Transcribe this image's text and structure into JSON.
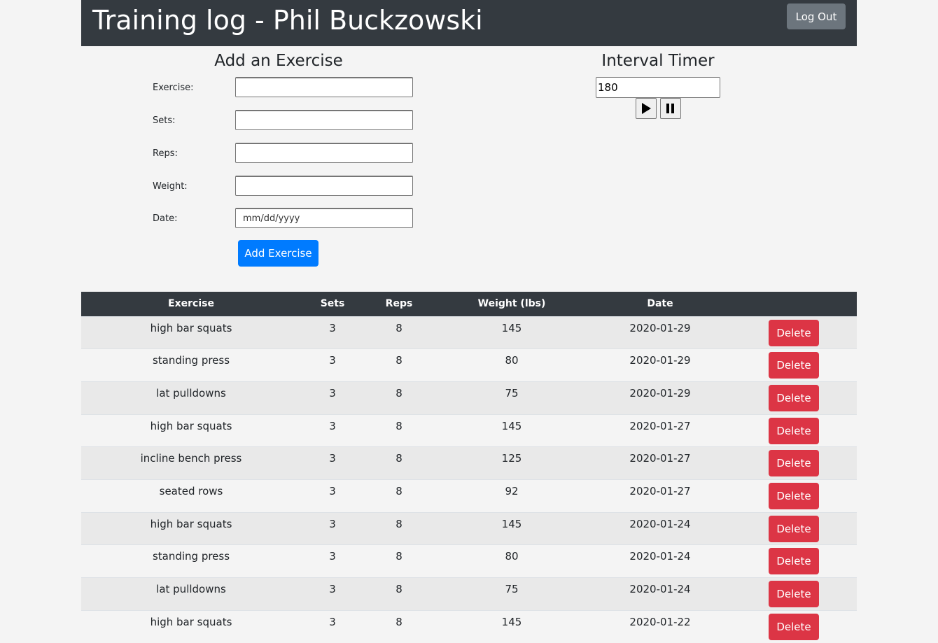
{
  "header": {
    "title": "Training log - Phil Buckzowski",
    "logout_label": "Log Out"
  },
  "add_form": {
    "title": "Add an Exercise",
    "exercise_label": "Exercise:",
    "sets_label": "Sets:",
    "reps_label": "Reps:",
    "weight_label": "Weight:",
    "date_label": "Date:",
    "exercise_value": "",
    "sets_value": "",
    "reps_value": "",
    "weight_value": "",
    "date_placeholder": "mm/dd/yyyy",
    "submit_label": "Add Exercise"
  },
  "timer": {
    "title": "Interval Timer",
    "value": "180",
    "play_icon": "play-icon",
    "pause_icon": "pause-icon"
  },
  "table": {
    "headers": [
      "Exercise",
      "Sets",
      "Reps",
      "Weight (lbs)",
      "Date",
      ""
    ],
    "delete_label": "Delete",
    "rows": [
      {
        "exercise": "high bar squats",
        "sets": "3",
        "reps": "8",
        "weight": "145",
        "date": "2020-01-29"
      },
      {
        "exercise": "standing press",
        "sets": "3",
        "reps": "8",
        "weight": "80",
        "date": "2020-01-29"
      },
      {
        "exercise": "lat pulldowns",
        "sets": "3",
        "reps": "8",
        "weight": "75",
        "date": "2020-01-29"
      },
      {
        "exercise": "high bar squats",
        "sets": "3",
        "reps": "8",
        "weight": "145",
        "date": "2020-01-27"
      },
      {
        "exercise": "incline bench press",
        "sets": "3",
        "reps": "8",
        "weight": "125",
        "date": "2020-01-27"
      },
      {
        "exercise": "seated rows",
        "sets": "3",
        "reps": "8",
        "weight": "92",
        "date": "2020-01-27"
      },
      {
        "exercise": "high bar squats",
        "sets": "3",
        "reps": "8",
        "weight": "145",
        "date": "2020-01-24"
      },
      {
        "exercise": "standing press",
        "sets": "3",
        "reps": "8",
        "weight": "80",
        "date": "2020-01-24"
      },
      {
        "exercise": "lat pulldowns",
        "sets": "3",
        "reps": "8",
        "weight": "75",
        "date": "2020-01-24"
      },
      {
        "exercise": "high bar squats",
        "sets": "3",
        "reps": "8",
        "weight": "145",
        "date": "2020-01-22"
      }
    ]
  },
  "colors": {
    "header_bg": "#343a40",
    "primary": "#007bff",
    "danger": "#dc3545",
    "secondary": "#6c757d"
  }
}
